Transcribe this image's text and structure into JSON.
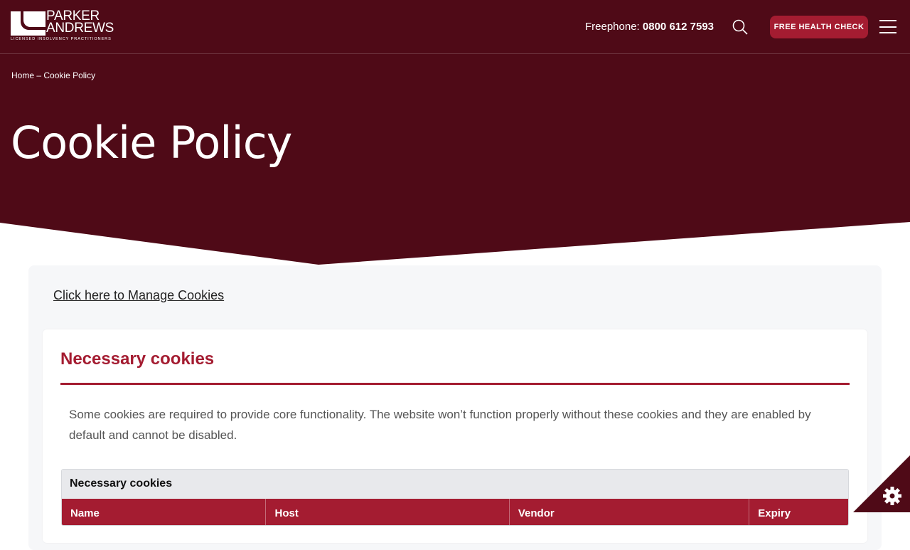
{
  "colors": {
    "hero_bg": "#4f0a17",
    "accent": "#a41c31",
    "panel_bg": "#f6f7f9"
  },
  "header": {
    "logo": {
      "line1": "PARKER",
      "line2": "ANDREWS",
      "tagline": "LICENSED INSOLVENCY PRACTITIONERS"
    },
    "freephone_label": "Freephone:",
    "freephone_number": "0800 612 7593",
    "search_icon": "search-icon",
    "cta_label": "FREE HEALTH CHECK",
    "menu_icon": "hamburger-menu-icon"
  },
  "breadcrumb": {
    "home": "Home",
    "separator": "–",
    "current": "Cookie Policy"
  },
  "page": {
    "title": "Cookie Policy"
  },
  "content": {
    "manage_link": "Click here to Manage Cookies",
    "section": {
      "title": "Necessary cookies",
      "description": "Some cookies are required to provide core functionality. The website won’t function properly without these cookies and they are enabled by default and cannot be disabled.",
      "table_caption": "Necessary cookies",
      "columns": [
        "Name",
        "Host",
        "Vendor",
        "Expiry"
      ]
    }
  },
  "cookie_settings_icon": "gear-icon"
}
